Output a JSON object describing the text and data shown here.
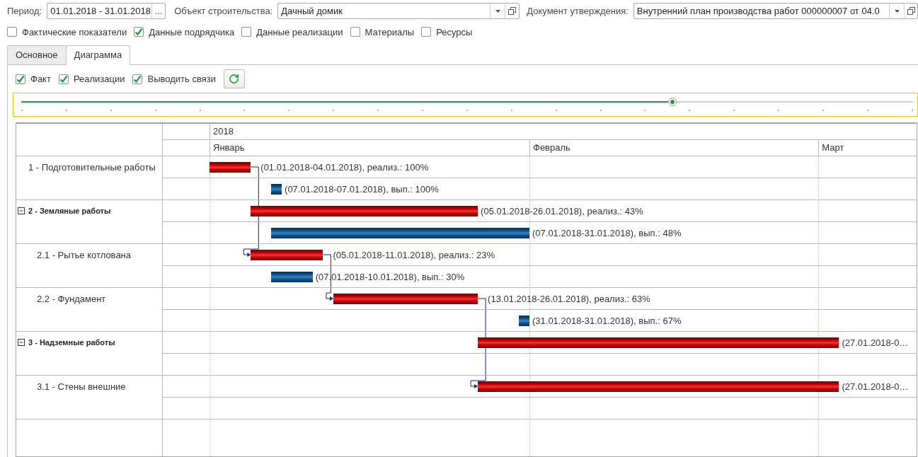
{
  "period": {
    "label": "Период:",
    "value": "01.01.2018 - 31.01.2018",
    "button": "..."
  },
  "object": {
    "label": "Объект строительства:",
    "value": "Дачный домик"
  },
  "document": {
    "label": "Документ утверждения:",
    "value": "Внутренний план производства работ 000000007 от 04.0"
  },
  "filters": [
    {
      "label": "Фактические показатели",
      "checked": false
    },
    {
      "label": "Данные подрядчика",
      "checked": true
    },
    {
      "label": "Данные реализации",
      "checked": false
    },
    {
      "label": "Материалы",
      "checked": false
    },
    {
      "label": "Ресурсы",
      "checked": false
    }
  ],
  "tabs": [
    {
      "label": "Основное",
      "selected": false
    },
    {
      "label": "Диаграмма",
      "selected": true
    }
  ],
  "diagram_options": [
    {
      "label": "Факт",
      "checked": true
    },
    {
      "label": "Реализации",
      "checked": true
    },
    {
      "label": "Выводить связи",
      "checked": true
    }
  ],
  "timeline_slider": {
    "level": 0.73
  },
  "gantt": {
    "year": "2018",
    "months": [
      "Январь",
      "Февраль",
      "Март"
    ],
    "rows": [
      {
        "kind": "task",
        "name": "1 - Подготовительные работы",
        "link_to_next_task": true,
        "bars": [
          {
            "kind": "realization",
            "label": "(01.01.2018-04.01.2018), реализ.: 100%"
          },
          {
            "kind": "fact",
            "label": "(07.01.2018-07.01.2018), вып.: 100%"
          }
        ]
      },
      {
        "kind": "group",
        "name": "2 - Земляные работы",
        "expanded": true,
        "link_to_next_task": false,
        "bars": [
          {
            "kind": "realization",
            "label": "(05.01.2018-26.01.2018), реализ.: 43%"
          },
          {
            "kind": "fact",
            "label": "(07.01.2018-31.01.2018), вып.: 48%"
          }
        ],
        "children": [
          {
            "kind": "task",
            "name": "2.1 - Рытье котлована",
            "link_to_next_task": true,
            "bars": [
              {
                "kind": "realization",
                "label": "(05.01.2018-11.01.2018), реализ.: 23%"
              },
              {
                "kind": "fact",
                "label": "(07.01.2018-10.01.2018), вып.: 30%"
              }
            ]
          },
          {
            "kind": "task",
            "name": "2.2 - Фундамент",
            "link_to_next_task": true,
            "bars": [
              {
                "kind": "realization",
                "label": "(13.01.2018-26.01.2018), реализ.: 63%"
              },
              {
                "kind": "fact",
                "label": "(31.01.2018-31.01.2018), вып.: 67%"
              }
            ]
          }
        ]
      },
      {
        "kind": "group",
        "name": "3 - Надземные работы",
        "expanded": true,
        "link_to_next_task": false,
        "bars": [
          {
            "kind": "realization",
            "label": "(27.01.2018-0…"
          }
        ],
        "children": [
          {
            "kind": "task",
            "name": "3.1 - Стены внешние",
            "link_to_next_task": false,
            "bars": [
              {
                "kind": "realization",
                "label": "(27.01.2018-0…"
              }
            ]
          }
        ]
      }
    ]
  }
}
